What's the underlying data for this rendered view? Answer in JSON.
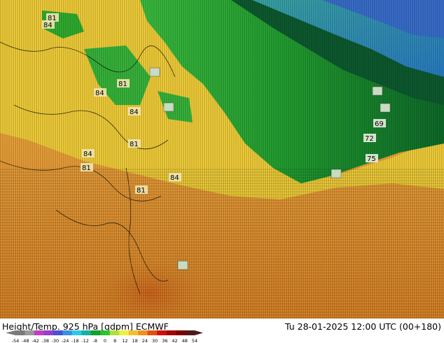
{
  "map": {
    "contour_labels": [
      {
        "text": "81",
        "row": 1
      },
      {
        "text": "84",
        "row": 2
      },
      {
        "text": "84",
        "row": 3
      },
      {
        "text": "81",
        "row": 4
      },
      {
        "text": "84",
        "row": 5
      },
      {
        "text": "81",
        "row": 6
      },
      {
        "text": "84",
        "row": 7
      },
      {
        "text": "81",
        "row": 8
      },
      {
        "text": "84",
        "row": 9
      },
      {
        "text": "81",
        "row": 10
      },
      {
        "text": "69",
        "row": 11
      },
      {
        "text": "72",
        "row": 12
      },
      {
        "text": "75",
        "row": 13
      }
    ]
  },
  "footer": {
    "title_left": "Height/Temp. 925 hPa [gdpm] ECMWF",
    "title_right": "Tu 28-01-2025 12:00 UTC (00+180)"
  },
  "scale": {
    "ticks": [
      "-54",
      "-48",
      "-42",
      "-38",
      "-30",
      "-24",
      "-18",
      "-12",
      "-8",
      "0",
      "8",
      "12",
      "18",
      "24",
      "30",
      "36",
      "42",
      "48",
      "54"
    ],
    "colors": [
      "#7a7a7a",
      "#9a9a9a",
      "#c03ec0",
      "#9640c8",
      "#4a50d0",
      "#3a90e0",
      "#30c8e8",
      "#18b0a0",
      "#10a030",
      "#30c030",
      "#b0e040",
      "#f0f040",
      "#f0c030",
      "#f09020",
      "#e05010",
      "#d01010",
      "#a00808",
      "#800000",
      "#501818"
    ]
  }
}
